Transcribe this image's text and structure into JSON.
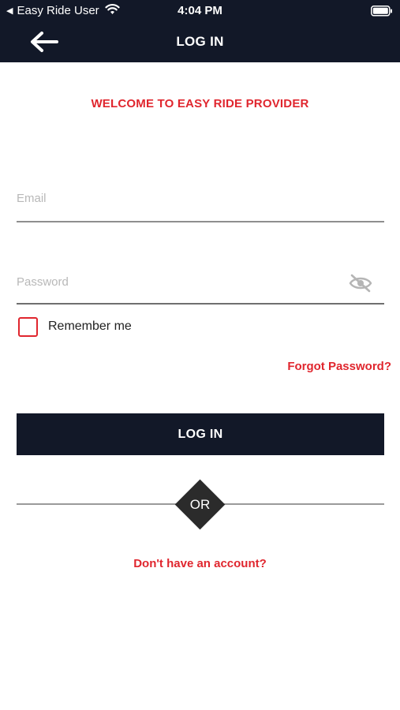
{
  "status_bar": {
    "back_app": "Easy Ride User",
    "time": "4:04 PM",
    "icons": [
      "back-triangle-icon",
      "wifi-icon",
      "battery-icon"
    ]
  },
  "header": {
    "title": "LOG IN",
    "back_icon": "arrow-left-icon"
  },
  "welcome": "WELCOME TO EASY RIDE PROVIDER",
  "form": {
    "email_placeholder": "Email",
    "email_value": "",
    "password_placeholder": "Password",
    "password_value": "",
    "password_toggle_icon": "eye-off-icon",
    "remember_label": "Remember me",
    "remember_checked": false,
    "forgot_label": "Forgot Password?",
    "login_label": "LOG IN"
  },
  "divider_label": "OR",
  "signup_label": "Don't have an account?",
  "colors": {
    "navy": "#121828",
    "accent_red": "#e0262e",
    "diamond": "#2b2b2b"
  }
}
